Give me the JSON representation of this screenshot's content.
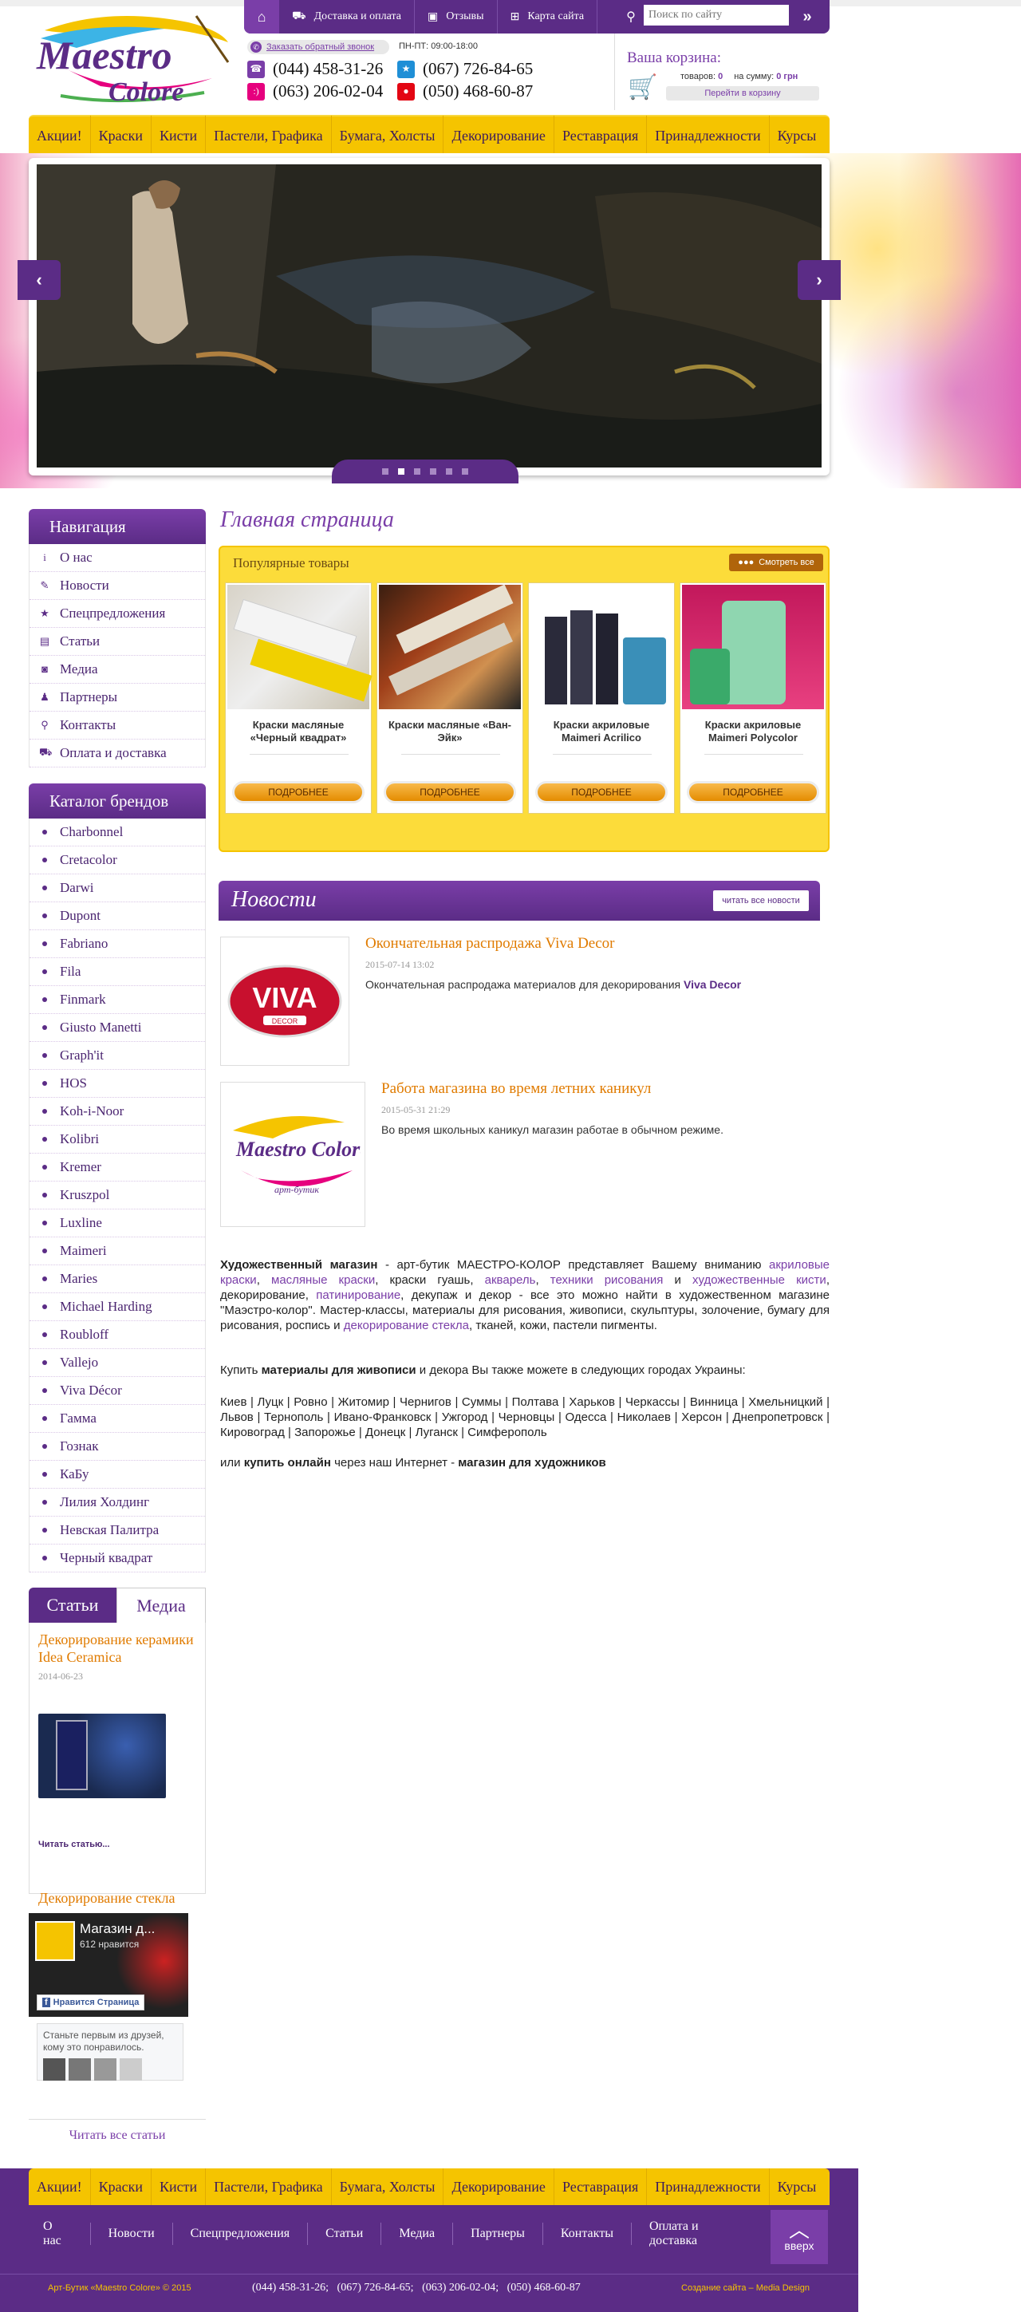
{
  "colors": {
    "brand_purple": "#5b2c86",
    "accent_yellow": "#f5c400",
    "link_orange": "#e07b00"
  },
  "topnav": {
    "home_icon": "home-icon",
    "items": [
      {
        "label": "Доставка и оплата",
        "icon": "truck-icon"
      },
      {
        "label": "Отзывы",
        "icon": "chat-icon"
      },
      {
        "label": "Карта сайта",
        "icon": "sitemap-icon"
      }
    ],
    "search_placeholder": "Поиск по сайту"
  },
  "header": {
    "logo_text": "Maestro Colore",
    "callback_label": "Заказать обратный звонок",
    "hours": "ПН-ПТ: 09:00-18:00",
    "phones": [
      "(044) 458-31-26",
      "(067) 726-84-65",
      "(063) 206-02-04",
      "(050) 468-60-87"
    ]
  },
  "cart": {
    "title": "Ваша корзина:",
    "items_label": "товаров:",
    "items_value": "0",
    "sum_label": "на сумму:",
    "sum_value": "0 грн",
    "go_label": "Перейти в корзину"
  },
  "menu": [
    "Акции!",
    "Краски",
    "Кисти",
    "Пастели, Графика",
    "Бумага, Холсты",
    "Декорирование",
    "Реставрация",
    "Принадлежности",
    "Курсы"
  ],
  "slider": {
    "prev": "‹",
    "next": "›",
    "dots": 6,
    "active": 2
  },
  "sidebar": {
    "nav_title": "Навигация",
    "nav": [
      {
        "label": "О нас",
        "icon": "info-icon"
      },
      {
        "label": "Новости",
        "icon": "pencil-icon"
      },
      {
        "label": "Спецпредложения",
        "icon": "star-icon"
      },
      {
        "label": "Статьи",
        "icon": "document-icon"
      },
      {
        "label": "Медиа",
        "icon": "camera-icon"
      },
      {
        "label": "Партнеры",
        "icon": "user-icon"
      },
      {
        "label": "Контакты",
        "icon": "map-pin-icon"
      },
      {
        "label": "Оплата и доставка",
        "icon": "truck-icon"
      }
    ],
    "brands_title": "Каталог брендов",
    "brands": [
      "Charbonnel",
      "Cretacolor",
      "Darwi",
      "Dupont",
      "Fabriano",
      "Fila",
      "Finmark",
      "Giusto Manetti",
      "Graph'it",
      "HOS",
      "Koh-i-Noor",
      "Kolibri",
      "Kremer",
      "Kruszpol",
      "Luxline",
      "Maimeri",
      "Maries",
      "Michael Harding",
      "Roubloff",
      "Vallejo",
      "Viva Décor",
      "Гамма",
      "Гознак",
      "КаБу",
      "Лилия Холдинг",
      "Невская Палитра",
      "Черный квадрат"
    ],
    "tabs": [
      "Статьи",
      "Медиа"
    ],
    "article1_title": "Декорирование керамики Idea Ceramica",
    "article1_date": "2014-06-23",
    "article1_read": "Читать статью...",
    "article2_title": "Декорирование стекла",
    "fb_name": "Магазин д...",
    "fb_likes": "612 нравится",
    "fb_like_button": "Нравится Страница",
    "fb_friends": "Станьте первым из друзей, кому это понравилось.",
    "read_all": "Читать все статьи"
  },
  "main": {
    "title": "Главная страница",
    "popular_title": "Популярные товары",
    "see_all": "Смотреть все",
    "products": [
      {
        "name": "Краски масляные «Черный квадрат»",
        "button": "ПОДРОБНЕЕ"
      },
      {
        "name": "Краски масляные «Ван-Эйк»",
        "button": "ПОДРОБНЕЕ"
      },
      {
        "name": "Краски акриловые Maimeri Acrilico",
        "button": "ПОДРОБНЕЕ"
      },
      {
        "name": "Краски акриловые Maimeri Polycolor",
        "button": "ПОДРОБНЕЕ"
      }
    ],
    "news_title": "Новости",
    "news_all": "читать все новости",
    "news": [
      {
        "title": "Окончательная распродажа Viva Decor",
        "date": "2015-07-14 13:02",
        "text": "Окончательная распродажа материалов для декорирования",
        "text_bold": "Viva Decor",
        "logo": "VIVA",
        "logo_sub": "DECOR"
      },
      {
        "title": "Работа магазина во время летних каникул",
        "date": "2015-05-31 21:29",
        "text": "Во время школьных каникул магазин работае в обычном режиме.",
        "logo": "Maestro Colore",
        "logo_sub": "арт-бутик"
      }
    ],
    "seo_p1_bold": "Художественный магазин",
    "seo_p1_a": " - арт-бутик МАЕСТРО-КОЛОР представляет Вашему вниманию ",
    "seo_link1": "акриловые краски",
    "seo_p1_b": ", ",
    "seo_link2": "масляные краски",
    "seo_p1_c": ", краски гуашь, ",
    "seo_link3": "акварель",
    "seo_p1_d": ", ",
    "seo_link4": "техники рисования",
    "seo_p1_e": " и ",
    "seo_link5": "художественные кисти",
    "seo_p1_f": ", декорирование, ",
    "seo_link6": "патинирование",
    "seo_p1_g": ",  декупаж и декор - все это можно найти в художественном магазине \"Маэстро-колор\". Мастер-классы, материалы для рисования, живописи, скульптуры, золочение, бумагу для рисования, роспись и ",
    "seo_link7": "декорирование стекла",
    "seo_p1_h": ", тканей, кожи, пастели пигменты.",
    "seo_p2_a": "Купить ",
    "seo_p2_bold": "материалы для живописи",
    "seo_p2_b": " и декора Вы также можете в следующих городах Украины:",
    "seo_cities": "Киев | Луцк | Ровно | Житомир | Чернигов | Суммы | Полтава |  Харьков | Черкассы | Винница | Хмельницкий | Львов | Тернополь | Ивано-Франковск | Ужгород | Черновцы | Одесса | Николаев | Херсон | Днепропетровск | Кировоград | Запорожье | Донецк | Луганск | Симферополь",
    "seo_p3_a": "или ",
    "seo_p3_bold1": "купить онлайн",
    "seo_p3_b": " через наш Интернет - ",
    "seo_p3_bold2": "магазин для художников"
  },
  "footer": {
    "nav": [
      "О нас",
      "Новости",
      "Спецпредложения",
      "Статьи",
      "Медиа",
      "Партнеры",
      "Контакты",
      "Оплата и доставка"
    ],
    "up": "вверх",
    "copyright": "Арт-Бутик «Maestro Colore» © 2015",
    "phones": "(044) 458-31-26;   (067) 726-84-65;   (063) 206-02-04;   (050) 468-60-87",
    "made_by": "Создание сайта – Media Design"
  }
}
